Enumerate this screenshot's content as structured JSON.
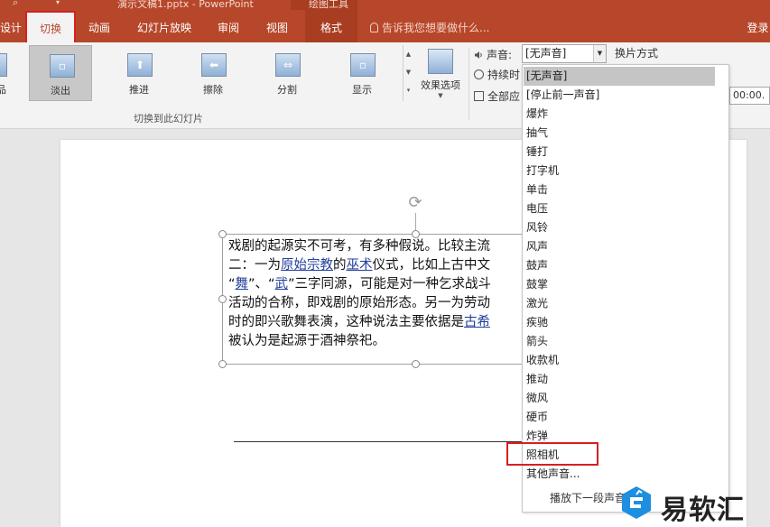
{
  "window": {
    "title": "演示文稿1.pptx - PowerPoint",
    "context_tab_group": "绘图工具"
  },
  "ribbon_tabs": [
    {
      "label": "设计"
    },
    {
      "label": "切换"
    },
    {
      "label": "动画"
    },
    {
      "label": "幻灯片放映"
    },
    {
      "label": "审阅"
    },
    {
      "label": "视图"
    },
    {
      "label": "格式"
    }
  ],
  "account": {
    "label": "登录"
  },
  "tellme": {
    "placeholder": "告诉我您想要做什么..."
  },
  "transitions": {
    "group_label": "切换到此幻灯片",
    "items": [
      {
        "label": "淡出",
        "glyph": "▫"
      },
      {
        "label": "推进",
        "glyph": "⬆"
      },
      {
        "label": "擦除",
        "glyph": "⬅"
      },
      {
        "label": "分割",
        "glyph": "⇔"
      },
      {
        "label": "显示",
        "glyph": "▫"
      }
    ],
    "partial_left_label": "品",
    "effect_options": "效果选项"
  },
  "timing": {
    "sound_label": "声音:",
    "sound_value": "[无声音]",
    "advance_label": "换片方式",
    "duration_label": "持续时",
    "apply_all_label": "全部应",
    "time_value": "00:00."
  },
  "sound_dropdown": {
    "items": [
      "[无声音]",
      "[停止前一声音]",
      "爆炸",
      "抽气",
      "锤打",
      "打字机",
      "单击",
      "电压",
      "风铃",
      "风声",
      "鼓声",
      "鼓掌",
      "激光",
      "疾驰",
      "箭头",
      "收款机",
      "推动",
      "微风",
      "硬币",
      "炸弹",
      "照相机",
      "其他声音..."
    ],
    "selected_index": 0,
    "highlighted_index": 20,
    "loop_label": "播放下一段声音"
  },
  "slide": {
    "lines": [
      {
        "segments": [
          {
            "t": "戏剧的起源实不可考，有多种假说。比较主流"
          }
        ]
      },
      {
        "segments": [
          {
            "t": "二：一为"
          },
          {
            "t": "原始宗教",
            "u": true
          },
          {
            "t": "的"
          },
          {
            "t": "巫术",
            "u": true
          },
          {
            "t": "仪式，比如上古中文"
          }
        ]
      },
      {
        "segments": [
          {
            "t": "“"
          },
          {
            "t": "舞",
            "u": true
          },
          {
            "t": "”、“"
          },
          {
            "t": "武",
            "u": true
          },
          {
            "t": "”三字同源，可能是对一种乞求战斗"
          }
        ]
      },
      {
        "segments": [
          {
            "t": "活动的合称，即戏剧的原始形态。另一为劳动"
          }
        ]
      },
      {
        "segments": [
          {
            "t": "时的即兴歌舞表演，这种说法主要依据是"
          },
          {
            "t": "古希",
            "u": true
          }
        ]
      },
      {
        "segments": [
          {
            "t": "被认为是起源于酒神祭祀。"
          }
        ]
      }
    ]
  },
  "watermark": {
    "text": "易软汇",
    "accent_color": "#1e8fe0"
  },
  "colors": {
    "accent": "#b7472a",
    "highlight": "#d62020"
  }
}
